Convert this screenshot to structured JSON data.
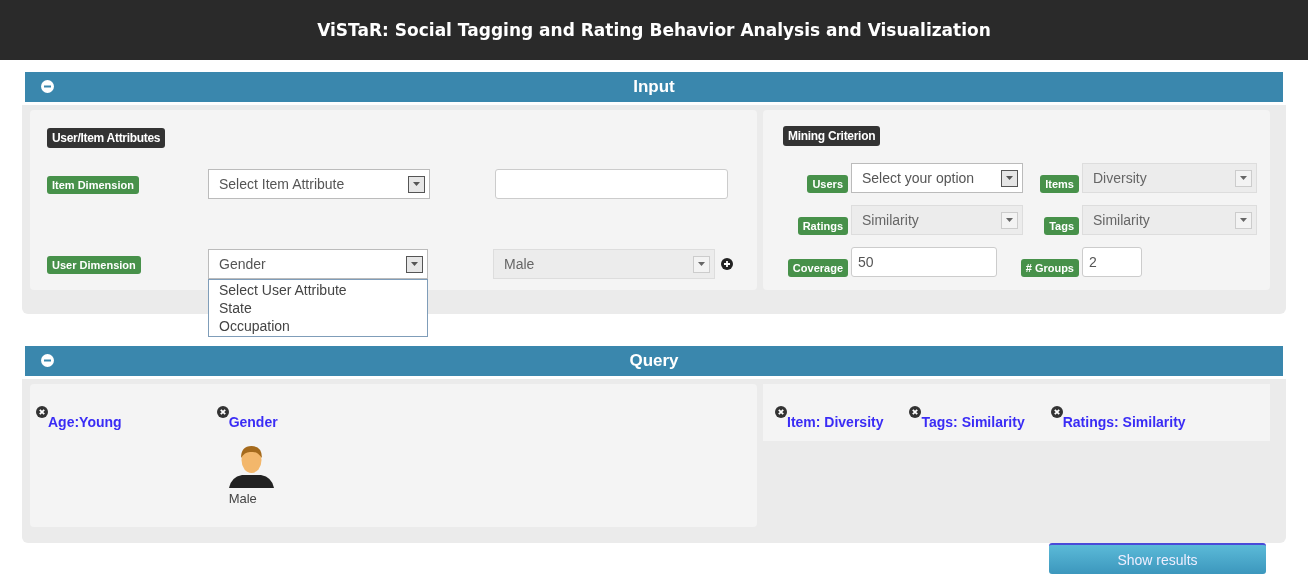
{
  "header": {
    "title": "ViSTaR: Social Tagging and Rating Behavior Analysis and Visualization"
  },
  "input_panel": {
    "title": "Input",
    "expanded": true,
    "attributes": {
      "heading": "User/Item Attributes",
      "rows": [
        {
          "label": "Item Dimension",
          "select": {
            "value": "Select Item Attribute",
            "open": false
          },
          "second": {
            "kind": "text"
          }
        },
        {
          "label": "User Dimension",
          "select": {
            "value": "Gender",
            "open": true,
            "options": [
              "Select User Attribute",
              "State",
              "Occupation"
            ]
          },
          "second": {
            "kind": "select",
            "value": "Male",
            "disabled": true,
            "add_icon": true
          }
        }
      ]
    },
    "mining": {
      "heading": "Mining Criterion",
      "fields": [
        {
          "label": "Users",
          "kind": "select",
          "value": "Select your option",
          "disabled": false
        },
        {
          "label": "Items",
          "kind": "select",
          "value": "Diversity",
          "disabled": true
        },
        {
          "label": "Ratings",
          "kind": "select",
          "value": "Similarity",
          "disabled": true
        },
        {
          "label": "Tags",
          "kind": "select",
          "value": "Similarity",
          "disabled": true
        },
        {
          "label": "Coverage",
          "kind": "text",
          "value": "50"
        },
        {
          "label": "# Groups",
          "kind": "text",
          "value": "2"
        }
      ]
    }
  },
  "query_panel": {
    "title": "Query",
    "expanded": true,
    "user_filters": [
      {
        "label": "Age:Young"
      },
      {
        "label": "Gender",
        "avatar_label": "Male"
      }
    ],
    "criteria": [
      {
        "label": "Item: Diversity"
      },
      {
        "label": "Tags: Similarity"
      },
      {
        "label": "Ratings: Similarity"
      }
    ]
  },
  "show_results_button": "Show results"
}
